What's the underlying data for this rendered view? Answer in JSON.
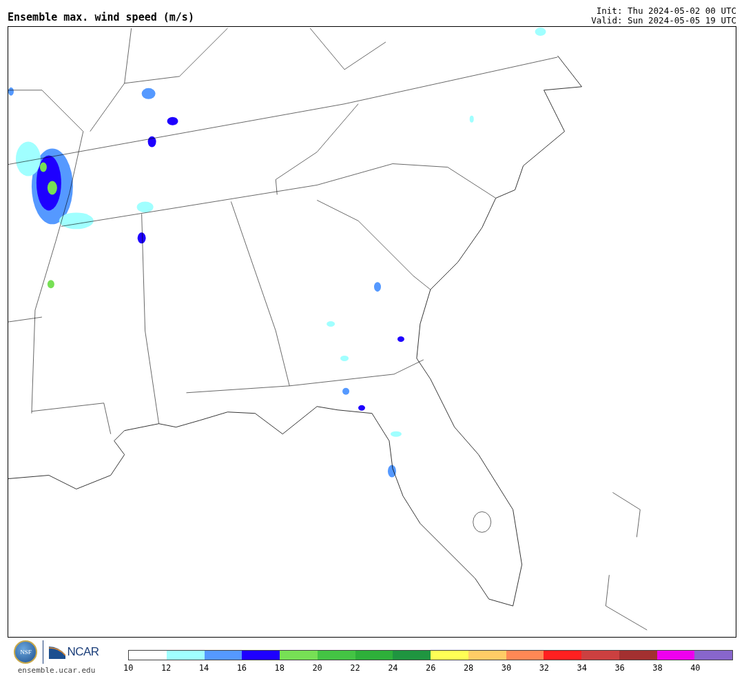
{
  "title": "Ensemble max. wind speed (m/s)",
  "init": "Init: Thu 2024-05-02 00 UTC",
  "valid": "Valid: Sun 2024-05-05 19 UTC",
  "logos": {
    "nsf": "NSF",
    "ncar": "NCAR",
    "site": "ensemble.ucar.edu"
  },
  "colorbar": {
    "bins": [
      {
        "color": "#ffffff"
      },
      {
        "color": "#a0ffff"
      },
      {
        "color": "#5599ff"
      },
      {
        "color": "#1e00ff"
      },
      {
        "color": "#77e055"
      },
      {
        "color": "#44c444"
      },
      {
        "color": "#2eb03a"
      },
      {
        "color": "#1f9540"
      },
      {
        "color": "#ffff55"
      },
      {
        "color": "#ffcc66"
      },
      {
        "color": "#ff8855"
      },
      {
        "color": "#ff2020"
      },
      {
        "color": "#cc4040"
      },
      {
        "color": "#a33030"
      },
      {
        "color": "#ee00ee"
      },
      {
        "color": "#8866cc"
      }
    ],
    "ticks": [
      "10",
      "12",
      "14",
      "16",
      "18",
      "20",
      "22",
      "24",
      "26",
      "28",
      "30",
      "32",
      "34",
      "36",
      "38",
      "40"
    ]
  }
}
